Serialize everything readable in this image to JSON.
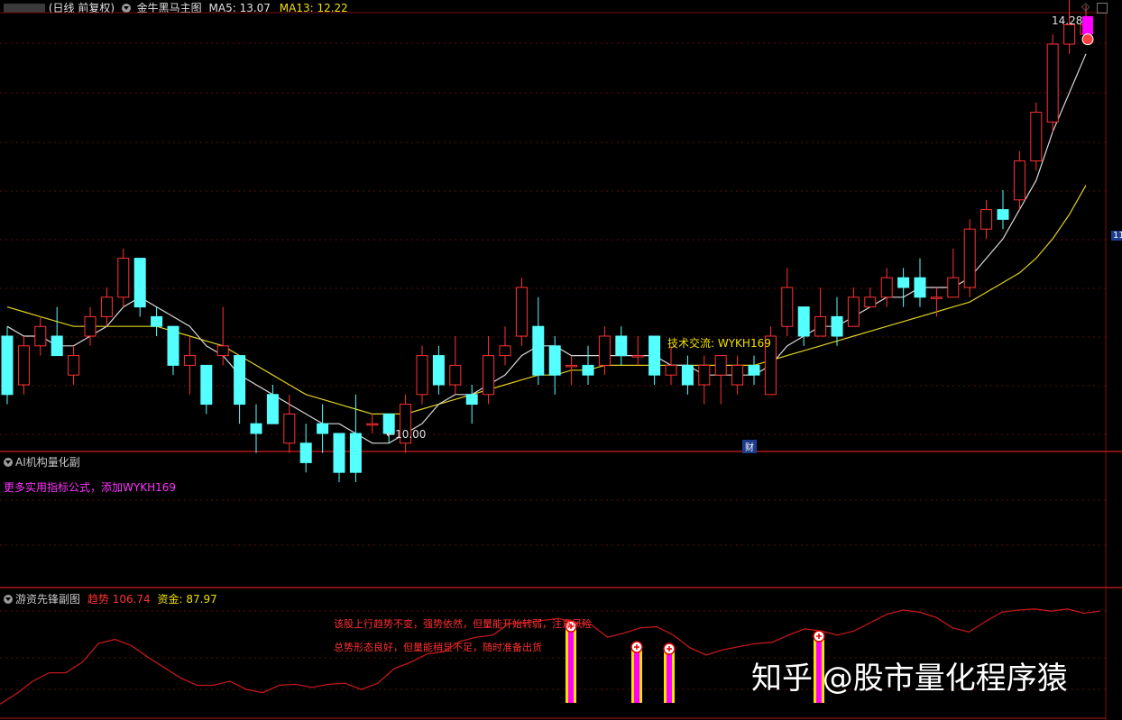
{
  "header": {
    "period": "(日线 前复权)",
    "chart_name": "金牛黑马主图",
    "ma5_label": "MA5: 13.07",
    "ma13_label": "MA13: 12.22"
  },
  "main_chart": {
    "price_high_label": "14.28",
    "price_low_label": "10.00",
    "contact_label": "技术交流: WYKH169",
    "event_badge": "财",
    "right_axis_label": "11",
    "colors": {
      "up": "#ff3232",
      "down": "#54ffff",
      "ma5": "#d8d8d8",
      "ma13": "#e0d020",
      "bar": "#ff00ff"
    },
    "candles": [
      [
        11.5,
        10.9,
        11.6,
        10.8
      ],
      [
        11.0,
        11.4,
        11.5,
        10.9
      ],
      [
        11.4,
        11.6,
        11.7,
        11.3
      ],
      [
        11.5,
        11.3,
        11.8,
        11.3
      ],
      [
        11.1,
        11.3,
        11.4,
        11.0
      ],
      [
        11.5,
        11.7,
        11.8,
        11.4
      ],
      [
        11.7,
        11.9,
        12.0,
        11.6
      ],
      [
        11.9,
        12.3,
        12.4,
        11.8
      ],
      [
        12.3,
        11.8,
        12.3,
        11.7
      ],
      [
        11.7,
        11.6,
        11.8,
        11.5
      ],
      [
        11.6,
        11.2,
        11.6,
        11.1
      ],
      [
        11.2,
        11.3,
        11.5,
        10.9
      ],
      [
        11.2,
        10.8,
        11.2,
        10.7
      ],
      [
        11.3,
        11.4,
        11.8,
        11.2
      ],
      [
        11.3,
        10.8,
        11.3,
        10.6
      ],
      [
        10.6,
        10.5,
        10.8,
        10.3
      ],
      [
        10.9,
        10.6,
        11.0,
        10.6
      ],
      [
        10.4,
        10.7,
        10.9,
        10.3
      ],
      [
        10.4,
        10.2,
        10.6,
        10.1
      ],
      [
        10.6,
        10.5,
        10.8,
        10.3
      ],
      [
        10.5,
        10.1,
        10.5,
        10.0
      ],
      [
        10.5,
        10.1,
        10.9,
        10.0
      ],
      [
        10.6,
        10.6,
        10.7,
        10.5
      ],
      [
        10.7,
        10.5,
        10.7,
        10.4
      ],
      [
        10.4,
        10.8,
        10.9,
        10.3
      ],
      [
        10.9,
        11.3,
        11.4,
        10.8
      ],
      [
        11.3,
        11.0,
        11.4,
        10.9
      ],
      [
        11.0,
        11.2,
        11.5,
        10.9
      ],
      [
        10.9,
        10.8,
        11.0,
        10.6
      ],
      [
        10.9,
        11.3,
        11.5,
        10.8
      ],
      [
        11.3,
        11.4,
        11.6,
        11.2
      ],
      [
        11.5,
        12.0,
        12.1,
        11.4
      ],
      [
        11.6,
        11.1,
        11.9,
        11.0
      ],
      [
        11.4,
        11.1,
        11.5,
        10.9
      ],
      [
        11.2,
        11.2,
        11.3,
        11.0
      ],
      [
        11.2,
        11.1,
        11.4,
        11.0
      ],
      [
        11.2,
        11.5,
        11.6,
        11.1
      ],
      [
        11.5,
        11.3,
        11.6,
        11.2
      ],
      [
        11.3,
        11.3,
        11.5,
        11.2
      ],
      [
        11.5,
        11.1,
        11.5,
        11.0
      ],
      [
        11.1,
        11.2,
        11.4,
        11.0
      ],
      [
        11.2,
        11.0,
        11.3,
        10.9
      ],
      [
        11.0,
        11.2,
        11.3,
        10.8
      ],
      [
        11.1,
        11.3,
        11.3,
        10.8
      ],
      [
        11.0,
        11.2,
        11.3,
        10.9
      ],
      [
        11.2,
        11.1,
        11.3,
        11.0
      ],
      [
        10.9,
        11.5,
        11.6,
        10.9
      ],
      [
        11.6,
        12.0,
        12.2,
        11.5
      ],
      [
        11.8,
        11.5,
        11.8,
        11.4
      ],
      [
        11.5,
        11.7,
        12.0,
        11.5
      ],
      [
        11.7,
        11.5,
        11.9,
        11.4
      ],
      [
        11.6,
        11.9,
        12.0,
        11.6
      ],
      [
        11.8,
        11.9,
        12.0,
        11.8
      ],
      [
        11.9,
        12.1,
        12.2,
        11.8
      ],
      [
        12.1,
        12.0,
        12.2,
        11.8
      ],
      [
        12.1,
        11.9,
        12.3,
        11.8
      ],
      [
        11.9,
        11.9,
        12.0,
        11.7
      ],
      [
        11.9,
        12.1,
        12.4,
        11.9
      ],
      [
        12.0,
        12.6,
        12.7,
        11.9
      ],
      [
        12.6,
        12.8,
        12.9,
        12.5
      ],
      [
        12.8,
        12.7,
        13.0,
        12.6
      ],
      [
        12.9,
        13.3,
        13.4,
        12.8
      ],
      [
        13.3,
        13.8,
        13.9,
        13.2
      ],
      [
        13.7,
        14.5,
        14.6,
        13.6
      ],
      [
        14.5,
        14.7,
        15.0,
        14.4
      ],
      [
        14.6,
        14.7,
        14.9,
        14.5
      ]
    ],
    "ma5": [
      11.6,
      11.5,
      11.5,
      11.4,
      11.4,
      11.5,
      11.6,
      11.8,
      11.9,
      11.8,
      11.7,
      11.6,
      11.4,
      11.3,
      11.1,
      11.0,
      10.9,
      10.8,
      10.7,
      10.6,
      10.6,
      10.5,
      10.4,
      10.4,
      10.5,
      10.6,
      10.8,
      10.9,
      10.9,
      11.0,
      11.1,
      11.3,
      11.4,
      11.4,
      11.3,
      11.3,
      11.3,
      11.3,
      11.3,
      11.3,
      11.2,
      11.2,
      11.1,
      11.1,
      11.1,
      11.1,
      11.2,
      11.4,
      11.5,
      11.6,
      11.6,
      11.7,
      11.8,
      11.9,
      11.9,
      12.0,
      12.0,
      12.0,
      12.1,
      12.3,
      12.5,
      12.8,
      13.1,
      13.6,
      14.0,
      14.4
    ],
    "ma13": [
      11.8,
      11.75,
      11.7,
      11.65,
      11.6,
      11.6,
      11.6,
      11.6,
      11.6,
      11.6,
      11.55,
      11.5,
      11.45,
      11.4,
      11.3,
      11.2,
      11.1,
      11.0,
      10.9,
      10.85,
      10.8,
      10.75,
      10.7,
      10.7,
      10.7,
      10.75,
      10.8,
      10.85,
      10.9,
      10.95,
      11.0,
      11.05,
      11.1,
      11.1,
      11.15,
      11.15,
      11.2,
      11.2,
      11.2,
      11.2,
      11.2,
      11.2,
      11.2,
      11.2,
      11.2,
      11.2,
      11.25,
      11.3,
      11.35,
      11.4,
      11.45,
      11.5,
      11.55,
      11.6,
      11.65,
      11.7,
      11.75,
      11.8,
      11.85,
      11.95,
      12.05,
      12.15,
      12.3,
      12.5,
      12.75,
      13.05
    ]
  },
  "panel2": {
    "title": "AI机构量化副",
    "promo_text": "更多实用指标公式，添加WYKH169"
  },
  "panel3": {
    "title": "游资先锋副图",
    "trend_label": "趋势",
    "trend_value": "106.74",
    "fund_label": "资金:",
    "fund_value": "87.97",
    "note1": "该股上行趋势不变，强势依然，但量能开始转弱，注意风险",
    "note2": "总势形态良好，但量能稍显不足，随时准备出货",
    "trend_line": [
      10,
      20,
      32,
      40,
      40,
      50,
      68,
      72,
      66,
      55,
      45,
      35,
      28,
      28,
      32,
      24,
      21,
      28,
      29,
      26,
      29,
      30,
      24,
      30,
      44,
      50,
      58,
      60,
      70,
      74,
      76,
      87,
      88,
      90,
      92,
      88,
      86,
      74,
      78,
      83,
      84,
      76,
      64,
      57,
      62,
      65,
      68,
      69,
      76,
      82,
      80,
      76,
      80,
      88,
      96,
      100,
      98,
      93,
      83,
      79,
      89,
      98,
      100,
      101,
      99,
      101,
      97,
      99
    ]
  },
  "watermark": "知乎 @股市量化程序猿"
}
